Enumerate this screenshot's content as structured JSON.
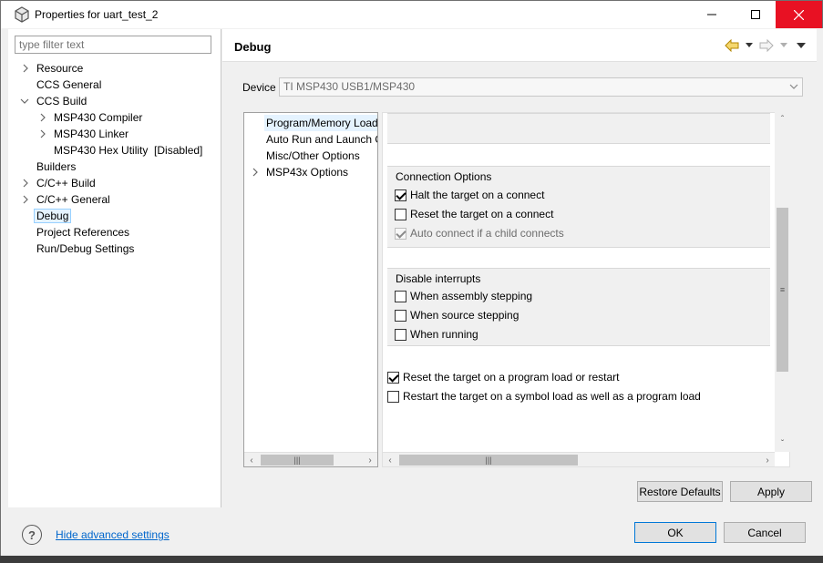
{
  "window": {
    "title": "Properties for uart_test_2"
  },
  "sidebar": {
    "filter_placeholder": "type filter text",
    "items": [
      {
        "label": "Resource"
      },
      {
        "label": "CCS General"
      },
      {
        "label": "CCS Build"
      },
      {
        "label": "MSP430 Compiler"
      },
      {
        "label": "MSP430 Linker"
      },
      {
        "label": "MSP430 Hex Utility  [Disabled]"
      },
      {
        "label": "Builders"
      },
      {
        "label": "C/C++ Build"
      },
      {
        "label": "C/C++ General"
      },
      {
        "label": "Debug"
      },
      {
        "label": "Project References"
      },
      {
        "label": "Run/Debug Settings"
      }
    ]
  },
  "main": {
    "title": "Debug",
    "device_label": "Device",
    "device_value": "TI MSP430 USB1/MSP430"
  },
  "inner_list": {
    "items": [
      {
        "label": "Program/Memory Load"
      },
      {
        "label": "Auto Run and Launch Options"
      },
      {
        "label": "Misc/Other Options"
      },
      {
        "label": "MSP43x Options"
      }
    ]
  },
  "options": {
    "connection_title": "Connection Options",
    "halt_label": "Halt the target on a connect",
    "halt_checked": true,
    "reset_connect_label": "Reset the target on a connect",
    "reset_connect_checked": false,
    "auto_connect_label": "Auto connect if a child connects",
    "auto_connect_checked": true,
    "interrupts_title": "Disable interrupts",
    "asm_step_label": "When assembly stepping",
    "src_step_label": "When source stepping",
    "running_label": "When running",
    "reset_load_label": "Reset the target on a program load or restart",
    "reset_load_checked": true,
    "restart_symbol_label": "Restart the target on a symbol load as well as a program load",
    "restart_symbol_checked": false
  },
  "buttons": {
    "restore_defaults": "Restore Defaults",
    "apply": "Apply",
    "ok": "OK",
    "cancel": "Cancel"
  },
  "footer": {
    "help": "?",
    "hide_advanced": "Hide advanced settings"
  }
}
